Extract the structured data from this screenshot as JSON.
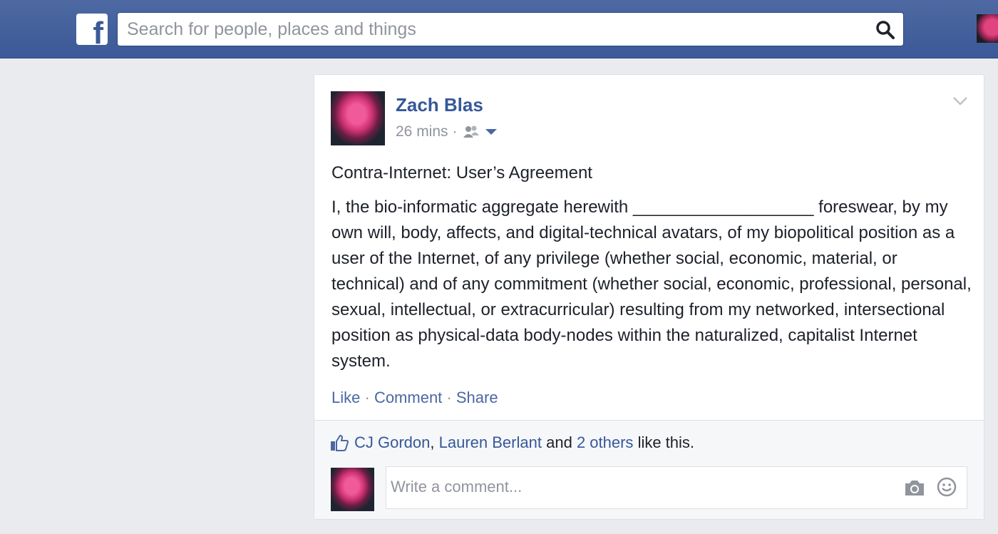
{
  "header": {
    "logo_letter": "f",
    "search_placeholder": "Search for people, places and things"
  },
  "post": {
    "author": "Zach Blas",
    "time": "26 mins",
    "dot": "·",
    "title": "Contra-Internet: User’s Agreement",
    "body": "I, the bio-informatic aggregate herewith ___________________ foreswear, by my own will, body, affects, and digital-technical avatars, of my biopolitical position as a user of the Internet, of any privilege (whether social, economic, material, or technical) and of any commitment (whether social, economic, professional, personal, sexual, intellectual, or extracurricular) resulting from my networked, intersectional position as physical-data body-nodes within the naturalized, capitalist Internet system.",
    "actions": {
      "like": "Like",
      "comment": "Comment",
      "share": "Share",
      "separator": "·"
    }
  },
  "likes": {
    "person1": "CJ Gordon",
    "comma": ",",
    "person2": "Lauren Berlant",
    "and": "and",
    "others": "2 others",
    "suffix": "like this."
  },
  "comment": {
    "placeholder": "Write a comment..."
  },
  "colors": {
    "brand": "#3b5998",
    "link": "#365899",
    "muted": "#90949c"
  }
}
